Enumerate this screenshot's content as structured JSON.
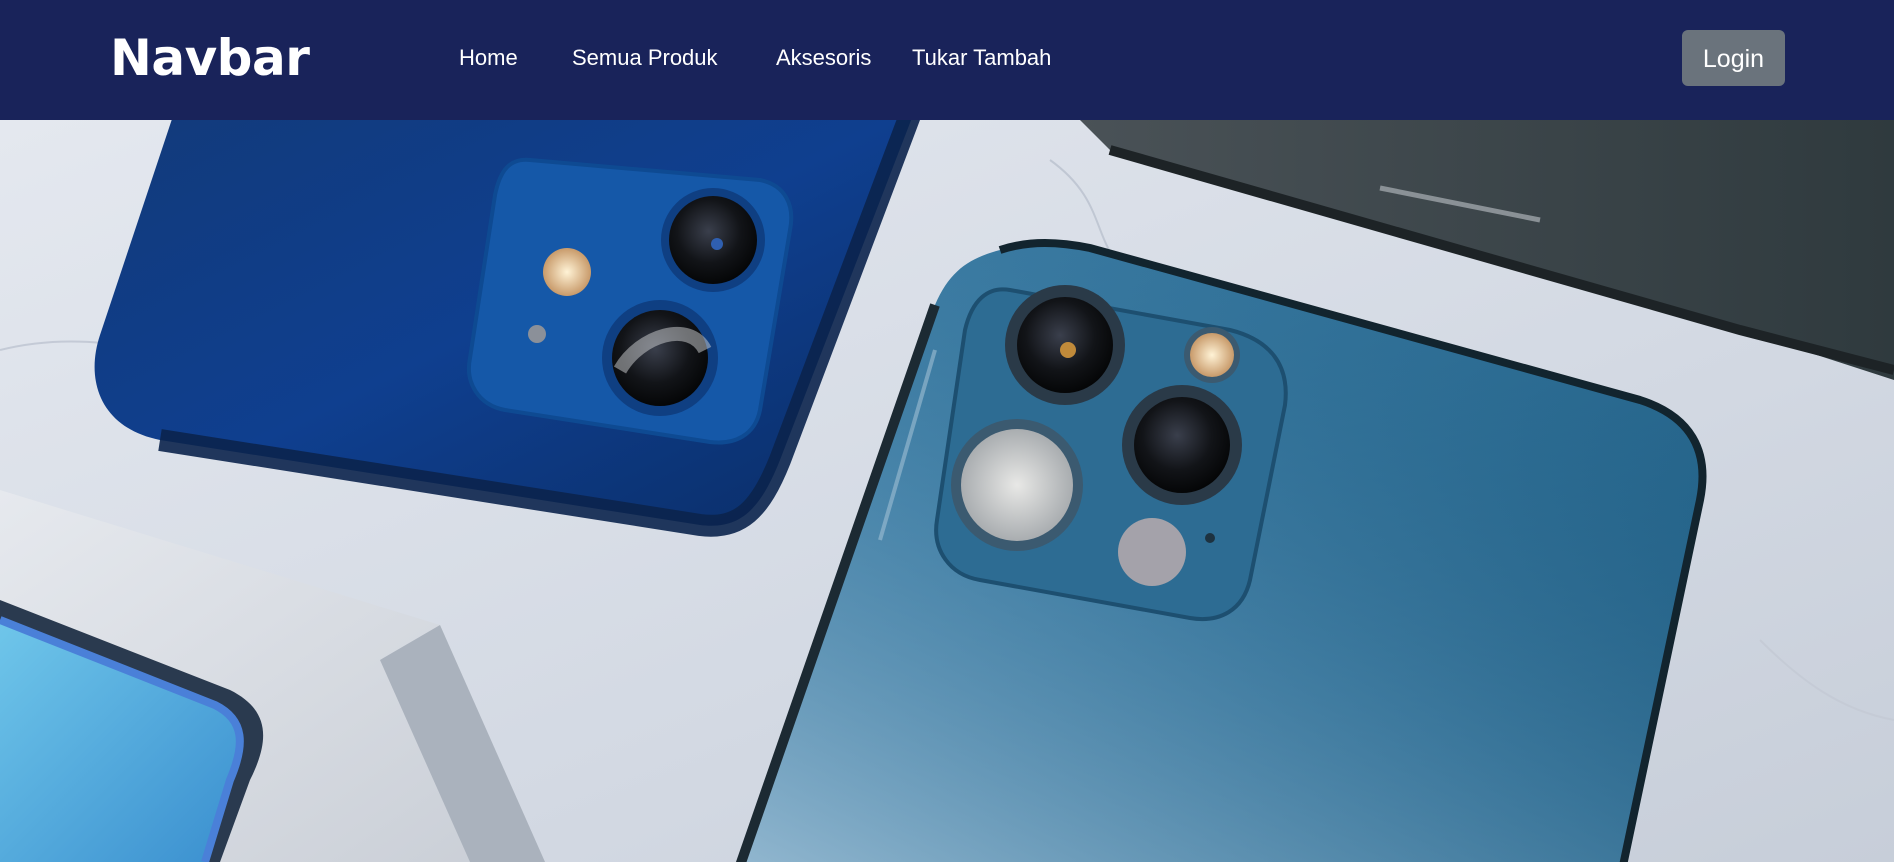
{
  "navbar": {
    "brand": "Navbar",
    "links": [
      "Home",
      "Semua Produk",
      "Aksesoris",
      "Tukar Tambah"
    ],
    "login_label": "Login"
  },
  "hero": {
    "image": "hero-photo"
  },
  "colors": {
    "navbar_bg": "#19235a",
    "login_bg": "#6a737c",
    "text": "#ffffff"
  }
}
